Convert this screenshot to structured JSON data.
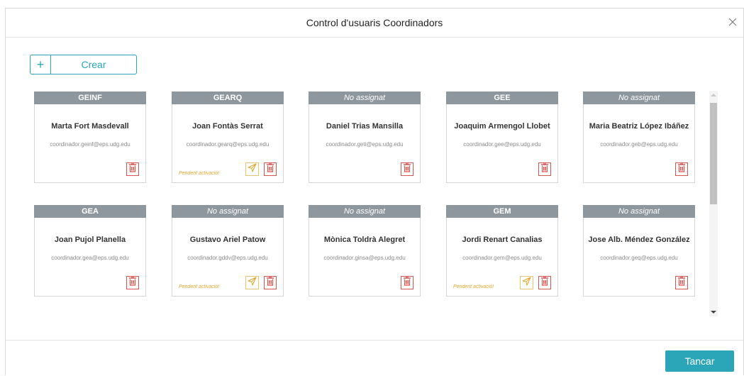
{
  "modal": {
    "title": "Control d'usuaris Coordinadors",
    "create_button": {
      "icon": "plus-icon",
      "label": "Crear"
    },
    "close_button_label": "Tancar",
    "colors": {
      "accent": "#2aa6b8",
      "card_header": "#8e979e",
      "delete": "#d9534f",
      "pending": "#e0a72a"
    }
  },
  "cards": [
    {
      "group": "GEINF",
      "assigned": true,
      "name": "Marta Fort Masdevall",
      "email": "coordinador.geinf@eps.udg.edu",
      "pending": ""
    },
    {
      "group": "GEARQ",
      "assigned": true,
      "name": "Joan Fontàs Serrat",
      "email": "coordinador.gearq@eps.udg.edu",
      "pending": "Pendent activació!"
    },
    {
      "group": "No assignat",
      "assigned": false,
      "name": "Daniel Trias Mansilla",
      "email": "coordinador.geti@eps.udg.edu",
      "pending": ""
    },
    {
      "group": "GEE",
      "assigned": true,
      "name": "Joaquim Armengol Llobet",
      "email": "coordinador.gee@eps.udg.edu",
      "pending": ""
    },
    {
      "group": "No assignat",
      "assigned": false,
      "name": "Maria Beatriz López Ibáñez",
      "email": "coordinador.geb@eps.udg.edu",
      "pending": ""
    },
    {
      "group": "GEA",
      "assigned": true,
      "name": "Joan Pujol Planella",
      "email": "coordinador.gea@eps.udg.edu",
      "pending": ""
    },
    {
      "group": "No assignat",
      "assigned": false,
      "name": "Gustavo Ariel Patow",
      "email": "coordinador.gddv@eps.udg.edu",
      "pending": "Pendent activació!"
    },
    {
      "group": "No assignat",
      "assigned": false,
      "name": "Mònica Toldrà Alegret",
      "email": "coordinador.ginsa@eps.udg.edu",
      "pending": ""
    },
    {
      "group": "GEM",
      "assigned": true,
      "name": "Jordi Renart Canalias",
      "email": "coordinador.gem@eps.udg.edu",
      "pending": "Pendent activació!"
    },
    {
      "group": "No assignat",
      "assigned": false,
      "name": "Jose Alb. Méndez González",
      "email": "coordinador.geq@eps.udg.edu",
      "pending": ""
    }
  ]
}
